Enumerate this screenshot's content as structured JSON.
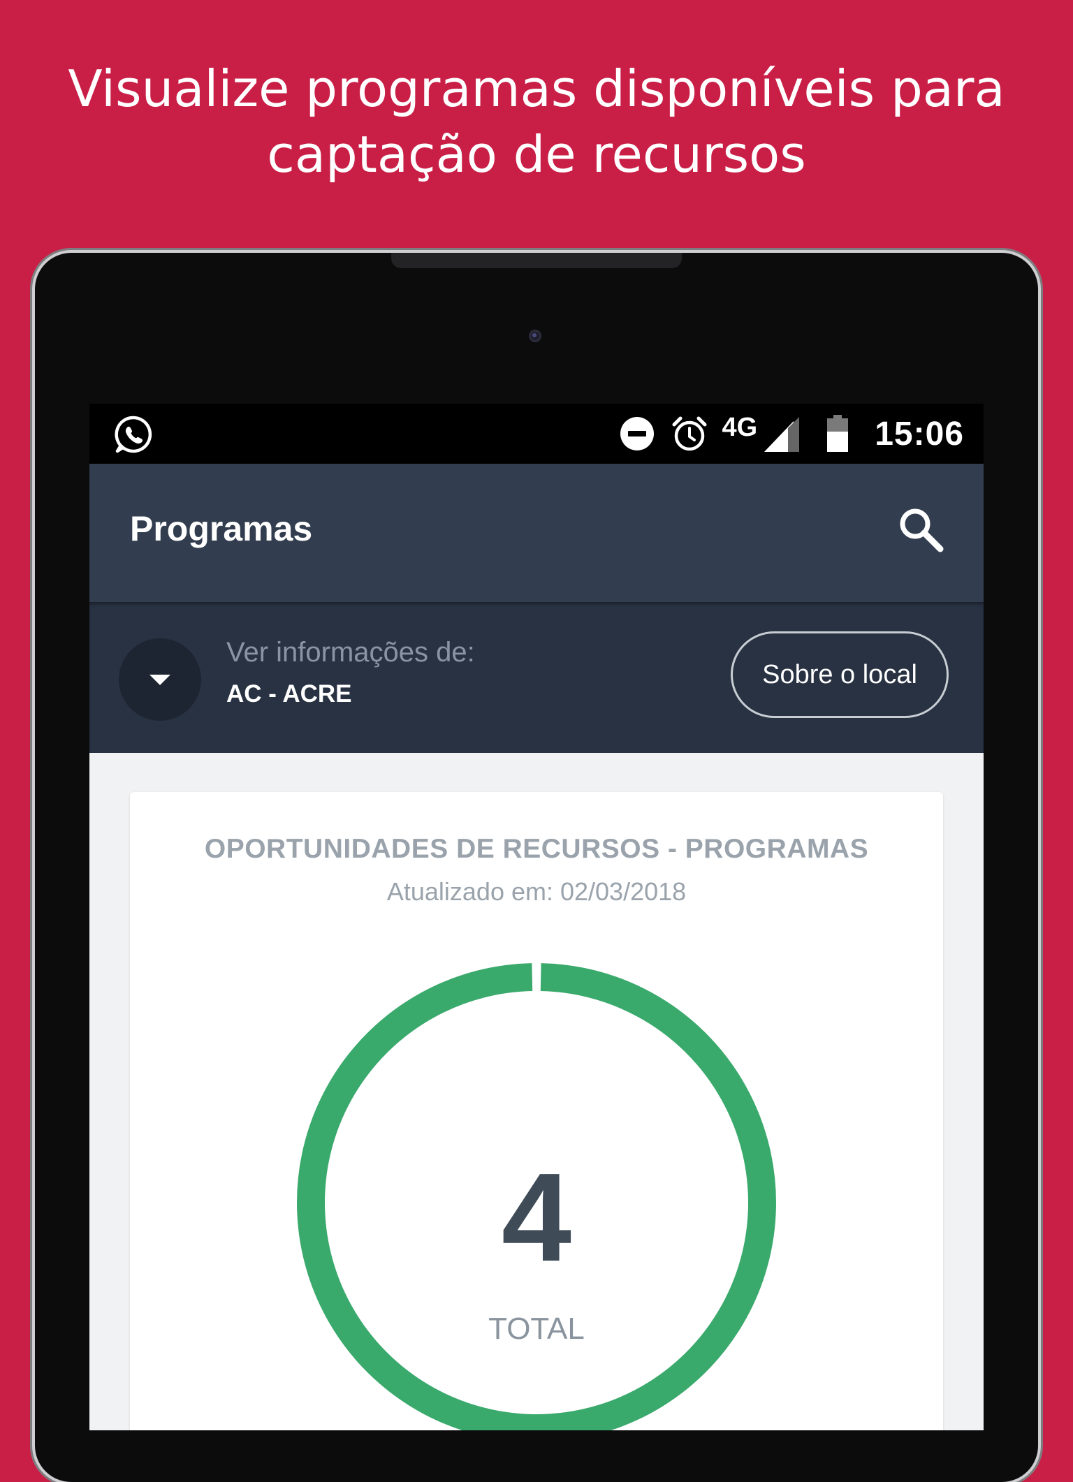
{
  "headline": {
    "line1": "Visualize programas disponíveis para",
    "line2": "captação de recursos"
  },
  "status_bar": {
    "left_icon": "whatsapp-icon",
    "icons": [
      "do-not-disturb-icon",
      "alarm-icon",
      "signal-icon",
      "battery-icon"
    ],
    "network": "4G",
    "time": "15:06"
  },
  "app_bar": {
    "title": "Programas",
    "search_icon": "search-icon"
  },
  "location": {
    "label": "Ver informações de:",
    "value": "AC - ACRE",
    "about_button": "Sobre o local",
    "toggle_icon": "caret-down-icon"
  },
  "card": {
    "title": "OPORTUNIDADES DE RECURSOS - PROGRAMAS",
    "updated": "Atualizado em: 02/03/2018",
    "total_value": "4",
    "total_label": "TOTAL"
  },
  "chart_data": {
    "type": "pie",
    "categories": [
      ""
    ],
    "values": [
      4
    ],
    "center_value": "4",
    "center_label": "TOTAL"
  },
  "colors": {
    "background": "#c91f47",
    "app_bar": "#323e4f",
    "location_bar": "#283242",
    "donut": "#3aa96c",
    "total_text": "#3f4b56"
  }
}
